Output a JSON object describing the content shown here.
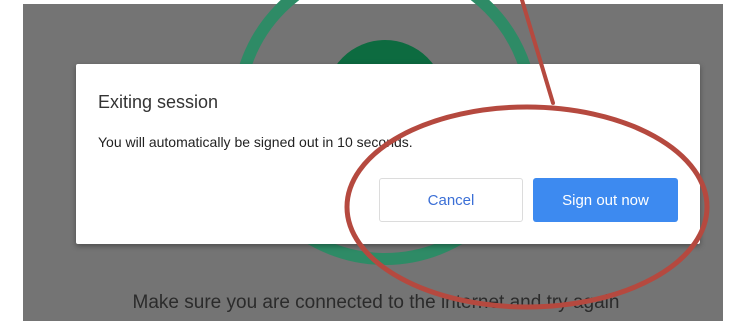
{
  "background": {
    "message": "Make sure you are connected to the internet and try again"
  },
  "dialog": {
    "title": "Exiting session",
    "body": "You will automatically be signed out in 10 seconds.",
    "cancel_label": "Cancel",
    "signout_label": "Sign out now"
  },
  "colors": {
    "backdrop": "#747474",
    "ring": "#2e8b66",
    "disc": "#0d6b40",
    "primary_button": "#3d8af0",
    "annotation": "#b5493f"
  },
  "icons": [
    "spinner-ring",
    "annotation-arrow-icon",
    "annotation-ellipse"
  ]
}
